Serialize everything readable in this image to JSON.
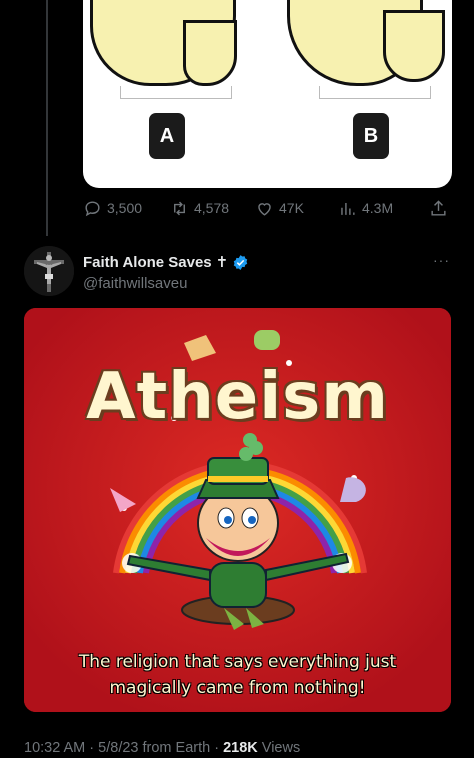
{
  "quiz_card": {
    "option_a": "A",
    "option_b": "B"
  },
  "previous_tweet_actions": {
    "replies": "3,500",
    "retweets": "4,578",
    "likes": "47K",
    "views": "4.3M"
  },
  "tweet": {
    "display_name": "Faith Alone Saves",
    "name_suffix": "✝",
    "handle": "@faithwillsaveu",
    "more": "···",
    "image": {
      "headline": "Atheism",
      "caption_line1": "The religion that says everything just",
      "caption_line2": "magically came from nothing!",
      "background_color": "#c41a1c"
    },
    "time": "10:32 AM",
    "date": "5/8/23",
    "source": "from Earth",
    "views_count": "218K",
    "views_label": "Views"
  },
  "colors": {
    "background": "#000000",
    "verified": "#1d9bf0",
    "muted": "#71767b",
    "text": "#e7e9ea"
  },
  "icons": [
    "reply-icon",
    "retweet-icon",
    "like-icon",
    "views-icon",
    "share-icon",
    "verified-badge-icon",
    "more-icon"
  ]
}
